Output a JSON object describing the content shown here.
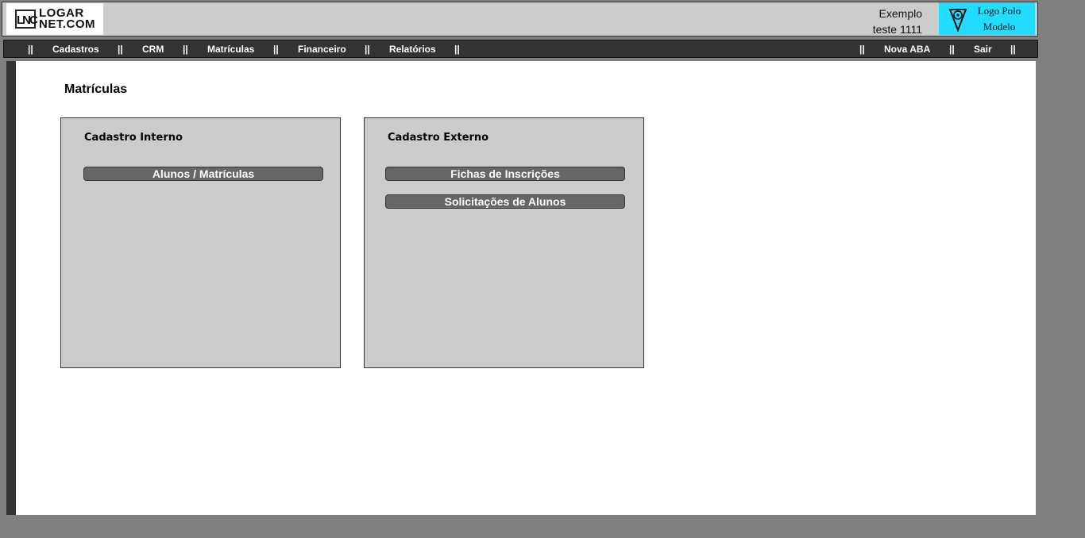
{
  "header": {
    "logo": {
      "mark": "LNC",
      "line1": "LOGAR",
      "line2": "NET.COM"
    },
    "user": {
      "line1": "Exemplo",
      "line2": "teste 1111"
    },
    "polo_logo": {
      "line1": "Logo Polo",
      "line2": "Modelo",
      "color": "#22ddff"
    }
  },
  "nav": {
    "separator": "||",
    "left_items": [
      "Cadastros",
      "CRM",
      "Matrículas",
      "Financeiro",
      "Relatórios"
    ],
    "right_items": [
      "Nova ABA",
      "Sair"
    ]
  },
  "main": {
    "title": "Matrículas",
    "cards": [
      {
        "title": "Cadastro Interno",
        "buttons": [
          "Alunos / Matrículas"
        ]
      },
      {
        "title": "Cadastro Externo",
        "buttons": [
          "Fichas de Inscrições",
          "Solicitações de Alunos"
        ]
      }
    ]
  },
  "colors": {
    "background": "#808080",
    "header_bg": "#cccccc",
    "nav_bg": "#333333",
    "card_bg": "#cccccc",
    "button_bg": "#666666"
  }
}
